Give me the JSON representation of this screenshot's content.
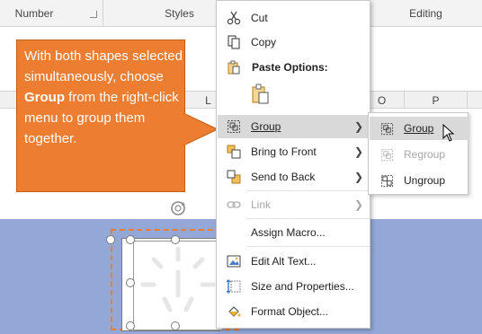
{
  "ribbon": {
    "groups": [
      "Number",
      "Styles",
      "Editing"
    ]
  },
  "columns": [
    "L",
    "O",
    "P"
  ],
  "callout": {
    "text_before": "With both shapes selected simultaneously, choose ",
    "bold": "Group",
    "text_after": " from the right-click menu to group them together.",
    "color": "#ed7d31"
  },
  "context_menu": {
    "cut": "Cut",
    "copy": "Copy",
    "paste_options": "Paste Options:",
    "group": "Group",
    "bring_to_front": "Bring to Front",
    "send_to_back": "Send to Back",
    "link": "Link",
    "assign_macro": "Assign Macro...",
    "edit_alt_text": "Edit Alt Text...",
    "size_and_properties": "Size and Properties...",
    "format_object": "Format Object..."
  },
  "submenu": {
    "group": "Group",
    "regroup": "Regroup",
    "ungroup": "Ungroup"
  },
  "colors": {
    "band": "#94a8d8",
    "hover": "#d9d9d9",
    "accent": "#ed7d31"
  }
}
